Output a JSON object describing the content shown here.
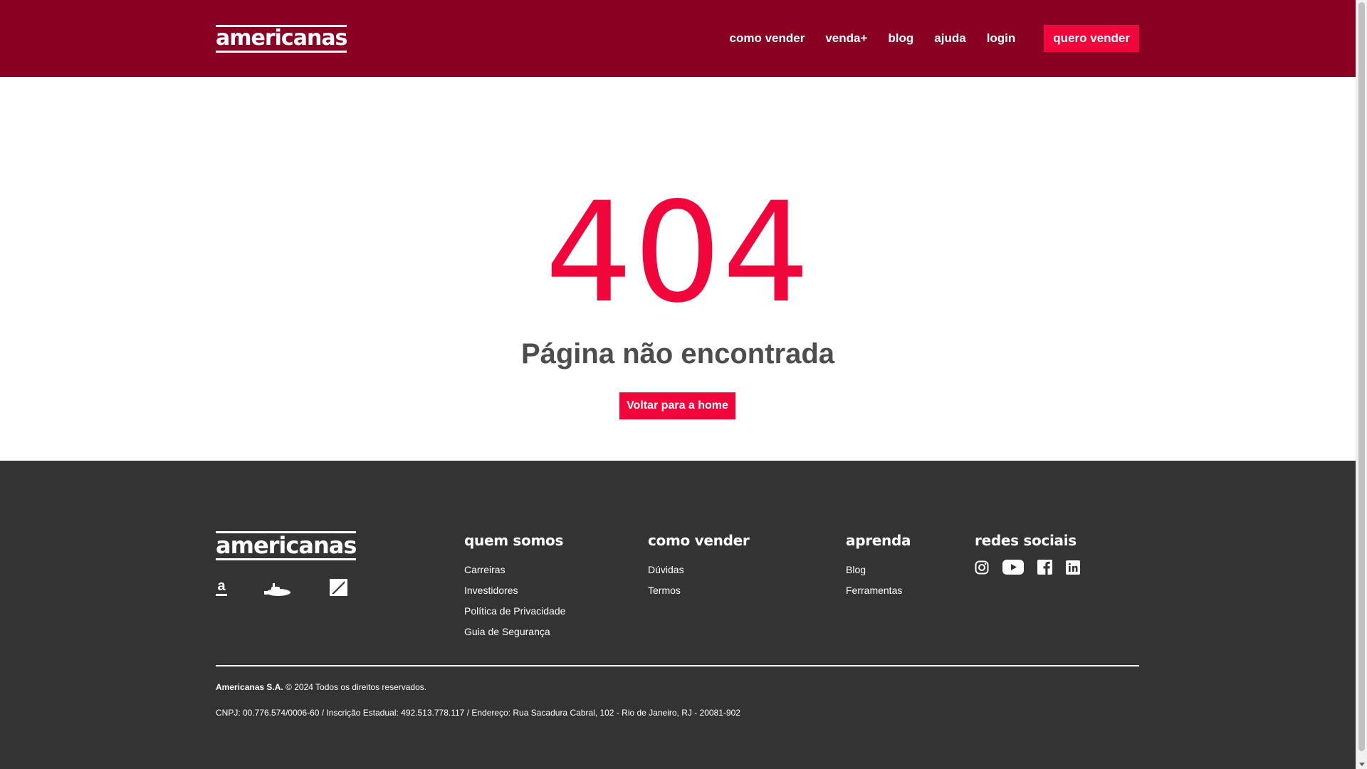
{
  "header": {
    "logo": "americanas",
    "nav": [
      {
        "label": "como vender"
      },
      {
        "label": "venda+"
      },
      {
        "label": "blog"
      },
      {
        "label": "ajuda"
      },
      {
        "label": "login"
      }
    ],
    "cta_label": "quero vender"
  },
  "main": {
    "code": "404",
    "message": "Página não encontrada",
    "home_button": "Voltar para a home"
  },
  "footer": {
    "logo": "americanas",
    "brand_icon_a": "a",
    "columns": {
      "quem_somos": {
        "title": "quem somos",
        "links": [
          "Carreiras",
          "Investidores",
          "Política de Privacidade",
          "Guia de Segurança"
        ]
      },
      "como_vender": {
        "title": "como vender",
        "links": [
          "Dúvidas",
          "Termos"
        ]
      },
      "aprenda": {
        "title": "aprenda",
        "links": [
          "Blog",
          "Ferramentas"
        ]
      },
      "redes_sociais": {
        "title": "redes sociais",
        "icons": [
          "instagram-icon",
          "youtube-icon",
          "facebook-icon",
          "linkedin-icon"
        ]
      }
    },
    "legal": {
      "company": "Americanas S.A.",
      "rights": " © 2024 Todos os direitos reservados.",
      "details": "CNPJ: 00.776.574/0006-60 / Inscrição Estadual: 492.513.778.117 / Endereço: Rua Sacadura Cabral, 102 - Rio de Janeiro, RJ - 20081-902"
    }
  },
  "colors": {
    "header_bg": "#8a0022",
    "accent": "#f0063a",
    "footer_bg": "#333333",
    "text_gray": "#4d4d4d"
  }
}
